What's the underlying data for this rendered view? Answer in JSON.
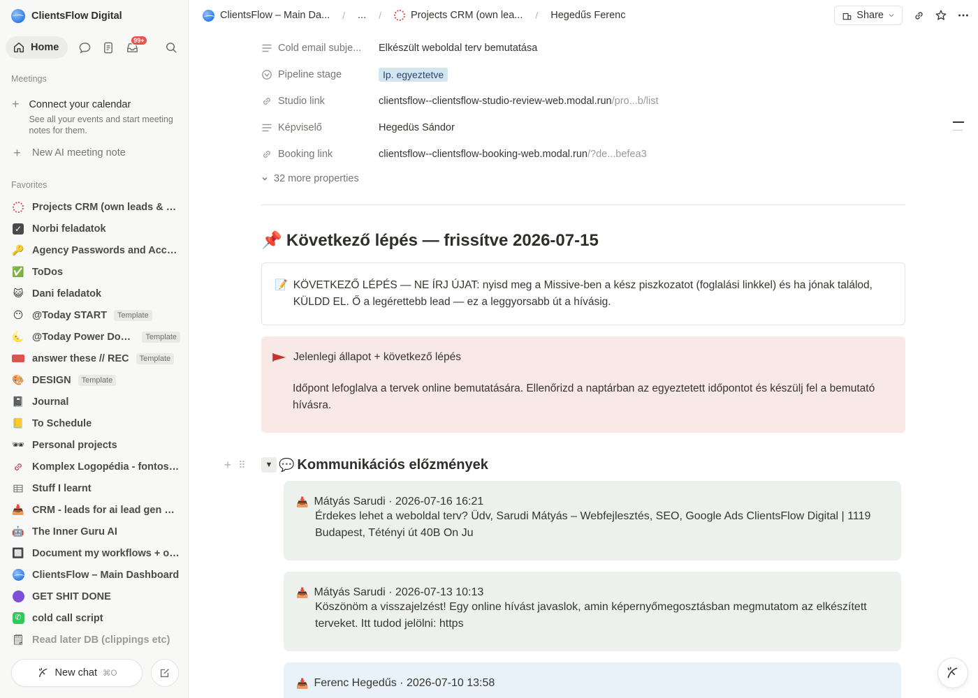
{
  "sidebar": {
    "workspace": "ClientsFlow Digital",
    "home_label": "Home",
    "inbox_badge": "99+",
    "meetings_label": "Meetings",
    "connect_calendar_title": "Connect your calendar",
    "connect_calendar_desc": "See all your events and start meeting notes for them.",
    "new_ai_note": "New AI meeting note",
    "favorites_label": "Favorites",
    "favorites": [
      {
        "label": "Projects CRM (own leads & cl...",
        "icon": "crm-dots-icon",
        "template": ""
      },
      {
        "label": "Norbi feladatok",
        "icon": "checkbox-icon",
        "template": ""
      },
      {
        "label": "Agency Passwords and Acco...",
        "icon": "key-icon",
        "template": ""
      },
      {
        "label": "ToDos",
        "icon": "check-mark-icon",
        "template": ""
      },
      {
        "label": "Dani feladatok",
        "icon": "cat-icon",
        "template": ""
      },
      {
        "label": "@Today START",
        "icon": "smile-icon",
        "template": "Template"
      },
      {
        "label": "@Today Power Dow...",
        "icon": "moon-icon",
        "template": "Template"
      },
      {
        "label": "answer these // REC",
        "icon": "video-camera-icon",
        "template": "Template"
      },
      {
        "label": "DESIGN",
        "icon": "palette-icon",
        "template": "Template"
      },
      {
        "label": "Journal",
        "icon": "notebook-icon",
        "template": ""
      },
      {
        "label": "To Schedule",
        "icon": "ledger-icon",
        "template": ""
      },
      {
        "label": "Personal projects",
        "icon": "sunglasses-icon",
        "template": ""
      },
      {
        "label": "Komplex Logopédia - fontos li...",
        "icon": "link-icon",
        "template": ""
      },
      {
        "label": "Stuff I learnt",
        "icon": "table-icon",
        "template": ""
      },
      {
        "label": "CRM - leads for ai lead gen of...",
        "icon": "inbox-tray-icon",
        "template": ""
      },
      {
        "label": "The Inner Guru AI",
        "icon": "robot-icon",
        "template": ""
      },
      {
        "label": "Document my workflows + op...",
        "icon": "chip-icon",
        "template": ""
      },
      {
        "label": "ClientsFlow – Main Dashboard",
        "icon": "globe-icon",
        "template": ""
      },
      {
        "label": "GET SHIT DONE",
        "icon": "purple-eye-icon",
        "template": ""
      },
      {
        "label": "cold call script",
        "icon": "phone-icon",
        "template": ""
      },
      {
        "label": "Read later DB (clippings etc)",
        "icon": "page-icon",
        "template": ""
      }
    ],
    "new_chat": "New chat",
    "new_chat_shortcut": "⌘O"
  },
  "topbar": {
    "crumbs": [
      "ClientsFlow – Main Da...",
      "...",
      "Projects CRM (own lea...",
      "Hegedűs Ferenc"
    ],
    "share": "Share"
  },
  "properties": [
    {
      "name": "Cold email subje...",
      "icon": "text-lines-icon",
      "value": "Elkészült weboldal terv bemutatása",
      "suffix": "",
      "tag": false
    },
    {
      "name": "Pipeline stage",
      "icon": "status-icon",
      "value": "Ip. egyeztetve",
      "suffix": "",
      "tag": true
    },
    {
      "name": "Studio link",
      "icon": "link-icon",
      "value": "clientsflow--clientsflow-studio-review-web.modal.run",
      "suffix": "/pro...b/list",
      "tag": false
    },
    {
      "name": "Képviselő",
      "icon": "text-lines-icon",
      "value": "Hegedüs Sándor",
      "suffix": "",
      "tag": false
    },
    {
      "name": "Booking link",
      "icon": "link-icon",
      "value": "clientsflow--clientsflow-booking-web.modal.run",
      "suffix": "/?de...befea3",
      "tag": false
    }
  ],
  "more_properties": "32 more properties",
  "content": {
    "next_heading": "Következő lépés — frissítve 2026-07-15",
    "next_box": "KÖVETKEZŐ LÉPÉS — NE ÍRJ ÚJAT: nyisd meg a Missive-ben a kész piszkozatot (foglalási linkkel) és ha jónak találod, KÜLDD EL. Ő a legérettebb lead — ez a leggyorsabb út a hívásig.",
    "status_title": "Jelenlegi állapot + következő lépés",
    "status_body": "Időpont lefoglalva a tervek online bemutatására. Ellenőrizd a naptárban az egyeztetett időpontot és készülj fel a bemutató hívásra.",
    "history_title": "Kommunikációs előzmények",
    "messages": [
      {
        "header": "Mátyás Sarudi · 2026-07-16 16:21",
        "body": "Érdekes lehet a weboldal terv? Üdv, Sarudi Mátyás – Webfejlesztés, SEO, Google Ads ClientsFlow Digital | 1119 Budapest, Tétényi út 40B On Ju",
        "color": "green"
      },
      {
        "header": "Mátyás Sarudi · 2026-07-13 10:13",
        "body": "Köszönöm a visszajelzést! Egy online hívást javaslok, amin képernyőmegosztásban megmutatom az elkészített terveket. Itt tudod jelölni: https",
        "color": "green"
      },
      {
        "header": "Ferenc Hegedűs · 2026-07-10 13:58",
        "body": "",
        "color": "blue"
      }
    ]
  }
}
